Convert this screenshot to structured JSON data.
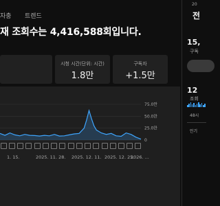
{
  "tabs": [
    "자충",
    "트렌드"
  ],
  "headline": "재 조회수는 4,416,588회입니다.",
  "stats": [
    {
      "label": "시청 시간(단위: 시간)",
      "value": "1.8만"
    },
    {
      "label": "구독자",
      "value": "+1.5만"
    }
  ],
  "chart": {
    "y_ticks": [
      "75.0만",
      "50.0만",
      "25.0만",
      "0"
    ],
    "x_ticks": [
      "1. 15.",
      "2025. 11. 28.",
      "2025. 12. 11.",
      "2025. 12. 25.",
      "2026. ..."
    ]
  },
  "chart_data": {
    "type": "area",
    "x": [
      "2025-11-12",
      "2025-11-14",
      "2025-11-16",
      "2025-11-18",
      "2025-11-20",
      "2025-11-22",
      "2025-11-24",
      "2025-11-26",
      "2025-11-28",
      "2025-11-30",
      "2025-12-02",
      "2025-12-04",
      "2025-12-06",
      "2025-12-08",
      "2025-12-10",
      "2025-12-12",
      "2025-12-14",
      "2025-12-16",
      "2025-12-17",
      "2025-12-18",
      "2025-12-19",
      "2025-12-20",
      "2025-12-21",
      "2025-12-23",
      "2025-12-25",
      "2025-12-27",
      "2025-12-29",
      "2025-12-31",
      "2026-01-02",
      "2026-01-04",
      "2026-01-06",
      "2026-01-08"
    ],
    "values": [
      140000,
      100000,
      150000,
      110000,
      90000,
      120000,
      100000,
      95000,
      85000,
      100000,
      90000,
      120000,
      85000,
      90000,
      110000,
      130000,
      140000,
      250000,
      420000,
      620000,
      450000,
      300000,
      210000,
      150000,
      120000,
      140000,
      90000,
      80000,
      150000,
      120000,
      60000,
      20000
    ],
    "ylim": [
      0,
      750000
    ],
    "y_ticks": [
      "75.0만",
      "50.0만",
      "25.0만",
      "0"
    ],
    "x_ticks": [
      "1. 15.",
      "2025. 11. 28.",
      "2025. 12. 11.",
      "2025. 12. 25.",
      "2026. ..."
    ],
    "grid": true,
    "color": "#3ea6ff"
  },
  "right_panel": {
    "top_label": "20",
    "title": "전",
    "count": "15,",
    "count_label": "구독",
    "count2": "12",
    "count2_label": "조회",
    "count3_label": "48시",
    "bottom_label": "인기"
  },
  "colors": {
    "accent": "#3ea6ff",
    "background": "#0f0f0f",
    "card": "#212121"
  }
}
